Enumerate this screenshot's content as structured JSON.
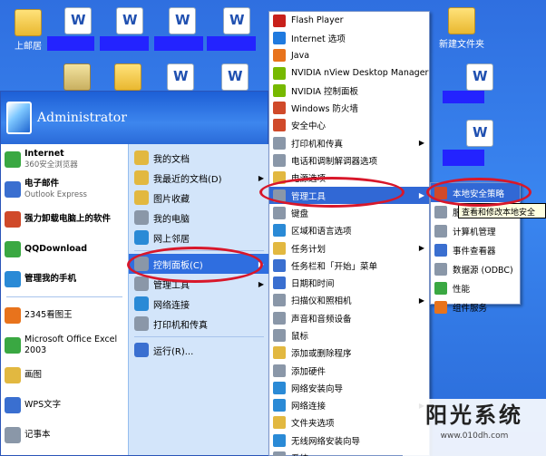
{
  "desktop": {
    "icons": [
      "上邮居",
      "新建文件夹"
    ]
  },
  "user": {
    "name": "Administrator"
  },
  "left_items": [
    {
      "label": "Internet",
      "sub": "360安全浏览器"
    },
    {
      "label": "电子邮件",
      "sub": "Outlook Express"
    },
    {
      "label": "强力卸载电脑上的软件",
      "sub": ""
    },
    {
      "label": "QQDownload",
      "sub": ""
    },
    {
      "label": "管理我的手机",
      "sub": ""
    },
    {
      "label": "2345看图王",
      "sub": ""
    },
    {
      "label": "Microsoft Office Excel 2003",
      "sub": ""
    },
    {
      "label": "画图",
      "sub": ""
    },
    {
      "label": "WPS文字",
      "sub": ""
    },
    {
      "label": "记事本",
      "sub": ""
    }
  ],
  "right_items": [
    "我的文档",
    "我最近的文档(D)",
    "图片收藏",
    "我的电脑",
    "网上邻居",
    "控制面板(C)",
    "管理工具",
    "网络连接",
    "打印机和传真",
    "运行(R)..."
  ],
  "control_panel_items": [
    "Flash Player",
    "Internet 选项",
    "Java",
    "NVIDIA nView Desktop Manager",
    "NVIDIA 控制面板",
    "Windows 防火墙",
    "安全中心",
    "打印机和传真",
    "电话和调制解调器选项",
    "电源选项",
    "管理工具",
    "键盘",
    "区域和语言选项",
    "任务计划",
    "任务栏和「开始」菜单",
    "日期和时间",
    "扫描仪和照相机",
    "声音和音频设备",
    "鼠标",
    "添加或删除程序",
    "添加硬件",
    "网络安装向导",
    "网络连接",
    "文件夹选项",
    "无线网络安装向导",
    "系统"
  ],
  "admin_tools_items": [
    "本地安全策略",
    "服务",
    "计算机管理",
    "事件查看器",
    "数据源 (ODBC)",
    "性能",
    "组件服务"
  ],
  "tooltip": "查看和修改本地安全",
  "watermark": {
    "title": "阳光系统",
    "url": "www.010dh.com"
  },
  "colors": {
    "highlight": "#3168d5",
    "annotation": "#d8172a"
  }
}
